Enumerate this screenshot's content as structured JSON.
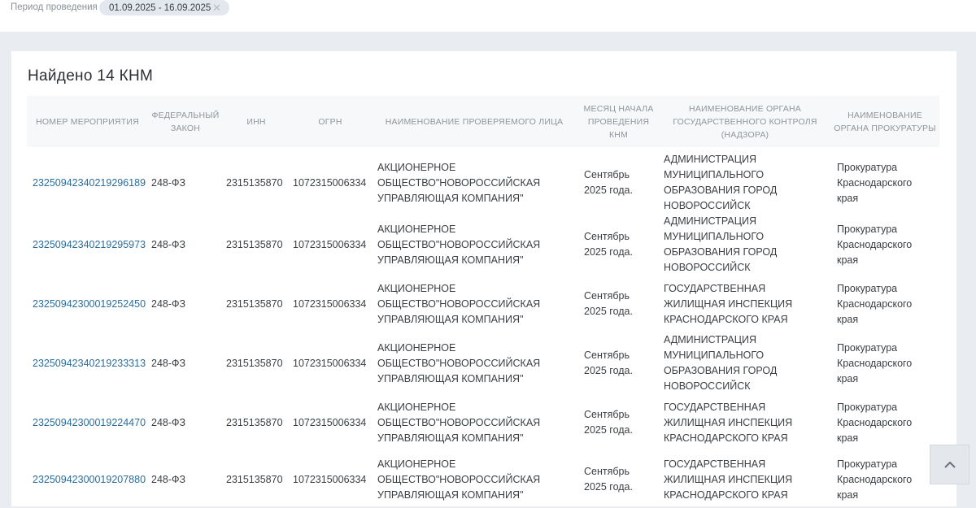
{
  "filter": {
    "label": "Период проведения",
    "date_range": "01.09.2025 - 16.09.2025",
    "clear_icon": "close-icon"
  },
  "results": {
    "title": "Найдено 14 КНМ"
  },
  "table": {
    "columns": [
      "НОМЕР МЕРОПРИЯТИЯ",
      "ФЕДЕРАЛЬНЫЙ ЗАКОН",
      "ИНН",
      "ОГРН",
      "НАИМЕНОВАНИЕ ПРОВЕРЯЕМОГО ЛИЦА",
      "МЕСЯЦ НАЧАЛА ПРОВЕДЕНИЯ КНМ",
      "НАИМЕНОВАНИЕ ОРГАНА ГОСУДАРСТВЕННОГО КОНТРОЛЯ (НАДЗОРА)",
      "НАИМЕНОВАНИЕ ОРГАНА ПРОКУРАТУРЫ"
    ],
    "rows": [
      {
        "number": "23250942340219296189",
        "law": "248-ФЗ",
        "inn": "2315135870",
        "ogrn": "1072315006334",
        "name": "АКЦИОНЕРНОЕ ОБЩЕСТВО\"НОВОРОССИЙСКАЯ УПРАВЛЯЮЩАЯ КОМПАНИЯ\"",
        "month": "Сентябрь 2025 года.",
        "organ": "АДМИНИСТРАЦИЯ МУНИЦИПАЛЬНОГО ОБРАЗОВАНИЯ ГОРОД НОВОРОССИЙСК",
        "prosecutor": "Прокуратура Краснодарского края"
      },
      {
        "number": "23250942340219295973",
        "law": "248-ФЗ",
        "inn": "2315135870",
        "ogrn": "1072315006334",
        "name": "АКЦИОНЕРНОЕ ОБЩЕСТВО\"НОВОРОССИЙСКАЯ УПРАВЛЯЮЩАЯ КОМПАНИЯ\"",
        "month": "Сентябрь 2025 года.",
        "organ": "АДМИНИСТРАЦИЯ МУНИЦИПАЛЬНОГО ОБРАЗОВАНИЯ ГОРОД НОВОРОССИЙСК",
        "prosecutor": "Прокуратура Краснодарского края"
      },
      {
        "number": "23250942300019252450",
        "law": "248-ФЗ",
        "inn": "2315135870",
        "ogrn": "1072315006334",
        "name": "АКЦИОНЕРНОЕ ОБЩЕСТВО\"НОВОРОССИЙСКАЯ УПРАВЛЯЮЩАЯ КОМПАНИЯ\"",
        "month": "Сентябрь 2025 года.",
        "organ": "ГОСУДАРСТВЕННАЯ ЖИЛИЩНАЯ ИНСПЕКЦИЯ КРАСНОДАРСКОГО КРАЯ",
        "prosecutor": "Прокуратура Краснодарского края"
      },
      {
        "number": "23250942340219233313",
        "law": "248-ФЗ",
        "inn": "2315135870",
        "ogrn": "1072315006334",
        "name": "АКЦИОНЕРНОЕ ОБЩЕСТВО\"НОВОРОССИЙСКАЯ УПРАВЛЯЮЩАЯ КОМПАНИЯ\"",
        "month": "Сентябрь 2025 года.",
        "organ": "АДМИНИСТРАЦИЯ МУНИЦИПАЛЬНОГО ОБРАЗОВАНИЯ ГОРОД НОВОРОССИЙСК",
        "prosecutor": "Прокуратура Краснодарского края"
      },
      {
        "number": "23250942300019224470",
        "law": "248-ФЗ",
        "inn": "2315135870",
        "ogrn": "1072315006334",
        "name": "АКЦИОНЕРНОЕ ОБЩЕСТВО\"НОВОРОССИЙСКАЯ УПРАВЛЯЮЩАЯ КОМПАНИЯ\"",
        "month": "Сентябрь 2025 года.",
        "organ": "ГОСУДАРСТВЕННАЯ ЖИЛИЩНАЯ ИНСПЕКЦИЯ КРАСНОДАРСКОГО КРАЯ",
        "prosecutor": "Прокуратура Краснодарского края"
      },
      {
        "number": "23250942300019207880",
        "law": "248-ФЗ",
        "inn": "2315135870",
        "ogrn": "1072315006334",
        "name": "АКЦИОНЕРНОЕ ОБЩЕСТВО\"НОВОРОССИЙСКАЯ УПРАВЛЯЮЩАЯ КОМПАНИЯ\"",
        "month": "Сентябрь 2025 года.",
        "organ": "ГОСУДАРСТВЕННАЯ ЖИЛИЩНАЯ ИНСПЕКЦИЯ КРАСНОДАРСКОГО КРАЯ",
        "prosecutor": "Прокуратура Краснодарского края"
      }
    ]
  },
  "scroll_top_icon": "chevron-up-icon",
  "colors": {
    "page_background": "#e9edf2",
    "link": "#2a6d9e",
    "header_text": "#8f959b",
    "chip_background": "#e3e8ee"
  }
}
